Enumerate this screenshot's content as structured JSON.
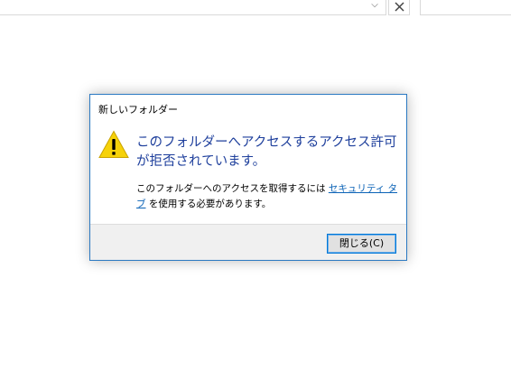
{
  "explorer": {
    "address_dropdown_icon": "chevron-down-icon",
    "address_close_icon": "close-icon"
  },
  "dialog": {
    "title": "新しいフォルダー",
    "icon": "warning-icon",
    "main_instruction": "このフォルダーへアクセスするアクセス許可が拒否されています。",
    "detail_prefix": "このフォルダーへのアクセスを取得するには",
    "detail_link": "セキュリティ タブ",
    "detail_suffix": "を使用する必要があります。",
    "close_button_label": "閉じる(C)",
    "accent_color": "#0078d7",
    "instruction_color": "#1e3f9c",
    "link_color": "#0a62b6"
  }
}
